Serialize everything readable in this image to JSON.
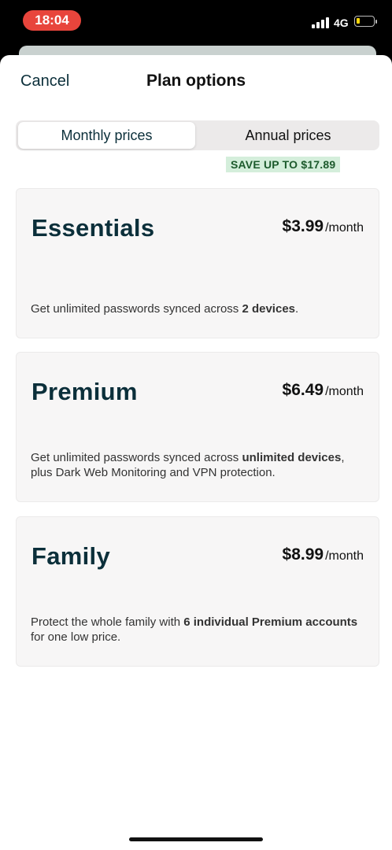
{
  "status_bar": {
    "time": "18:04",
    "network": "4G",
    "battery_level": 0.2,
    "battery_color": "#ffd60a"
  },
  "header": {
    "cancel_label": "Cancel",
    "title": "Plan options"
  },
  "billing_toggle": {
    "monthly_label": "Monthly prices",
    "annual_label": "Annual prices",
    "selected": "monthly",
    "save_badge": "SAVE UP TO $17.89"
  },
  "plans": [
    {
      "name": "Essentials",
      "price": "$3.99",
      "period": "/month",
      "desc_parts": [
        {
          "text": "Get unlimited passwords synced across ",
          "bold": false
        },
        {
          "text": "2 devices",
          "bold": true
        },
        {
          "text": ".",
          "bold": false
        }
      ]
    },
    {
      "name": "Premium",
      "price": "$6.49",
      "period": "/month",
      "desc_parts": [
        {
          "text": "Get unlimited passwords synced across ",
          "bold": false
        },
        {
          "text": "unlimited devices",
          "bold": true
        },
        {
          "text": ", plus Dark Web Monitoring and VPN protection.",
          "bold": false
        }
      ]
    },
    {
      "name": "Family",
      "price": "$8.99",
      "period": "/month",
      "desc_parts": [
        {
          "text": "Protect the whole family with ",
          "bold": false
        },
        {
          "text": "6 individual Premium accounts",
          "bold": true
        },
        {
          "text": " for one low price.",
          "bold": false
        }
      ]
    }
  ],
  "colors": {
    "brand_dark": "#0b2f3a",
    "status_time_pill": "#e8453c",
    "save_badge_bg": "#d4eedb",
    "save_badge_text": "#1c5a2c"
  }
}
